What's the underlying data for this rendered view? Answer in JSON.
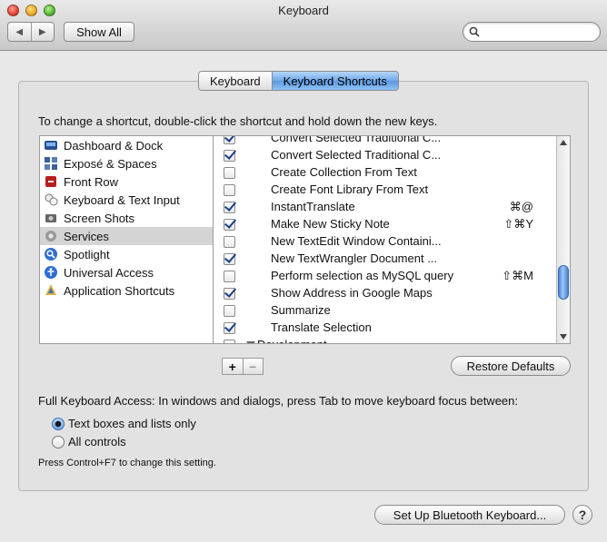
{
  "window": {
    "title": "Keyboard"
  },
  "toolbar": {
    "back_label": "◀",
    "forward_label": "▶",
    "show_all_label": "Show All",
    "search_placeholder": ""
  },
  "tabs": [
    {
      "label": "Keyboard",
      "active": false
    },
    {
      "label": "Keyboard Shortcuts",
      "active": true
    }
  ],
  "instructions": "To change a shortcut, double-click the shortcut and hold down the new keys.",
  "categories": [
    {
      "label": "Dashboard & Dock",
      "icon": "dashboard-icon"
    },
    {
      "label": "Exposé & Spaces",
      "icon": "expose-icon"
    },
    {
      "label": "Front Row",
      "icon": "front-row-icon"
    },
    {
      "label": "Keyboard & Text Input",
      "icon": "keyboard-icon"
    },
    {
      "label": "Screen Shots",
      "icon": "camera-icon"
    },
    {
      "label": "Services",
      "icon": "gear-icon",
      "selected": true
    },
    {
      "label": "Spotlight",
      "icon": "spotlight-icon"
    },
    {
      "label": "Universal Access",
      "icon": "accessibility-icon"
    },
    {
      "label": "Application Shortcuts",
      "icon": "application-icon"
    }
  ],
  "shortcuts": [
    {
      "label": "Convert Selected Traditional C...",
      "checked": true,
      "key": ""
    },
    {
      "label": "Convert Selected Traditional C...",
      "checked": true,
      "key": ""
    },
    {
      "label": "Create Collection From Text",
      "checked": false,
      "key": ""
    },
    {
      "label": "Create Font Library From Text",
      "checked": false,
      "key": ""
    },
    {
      "label": "InstantTranslate",
      "checked": true,
      "key": "⌘@"
    },
    {
      "label": "Make New Sticky Note",
      "checked": true,
      "key": "⇧⌘Y"
    },
    {
      "label": "New TextEdit Window Containi...",
      "checked": false,
      "key": ""
    },
    {
      "label": "New TextWrangler Document ...",
      "checked": true,
      "key": ""
    },
    {
      "label": "Perform selection as MySQL query",
      "checked": false,
      "key": "⇧⌘M"
    },
    {
      "label": "Show Address in Google Maps",
      "checked": true,
      "key": ""
    },
    {
      "label": "Summarize",
      "checked": false,
      "key": ""
    },
    {
      "label": "Translate Selection",
      "checked": true,
      "key": ""
    }
  ],
  "group_row": {
    "label": "Development",
    "checked": false
  },
  "buttons": {
    "plus": "+",
    "minus": "−",
    "restore_defaults": "Restore Defaults",
    "bluetooth": "Set Up Bluetooth Keyboard...",
    "help": "?"
  },
  "full_keyboard_access": {
    "label": "Full Keyboard Access: In windows and dialogs, press Tab to move keyboard focus between:",
    "options": [
      {
        "label": "Text boxes and lists only",
        "selected": true
      },
      {
        "label": "All controls",
        "selected": false
      }
    ],
    "note": "Press Control+F7 to change this setting."
  },
  "colors": {
    "selection": "#d4d4d4",
    "accent": "#5c98e0"
  }
}
